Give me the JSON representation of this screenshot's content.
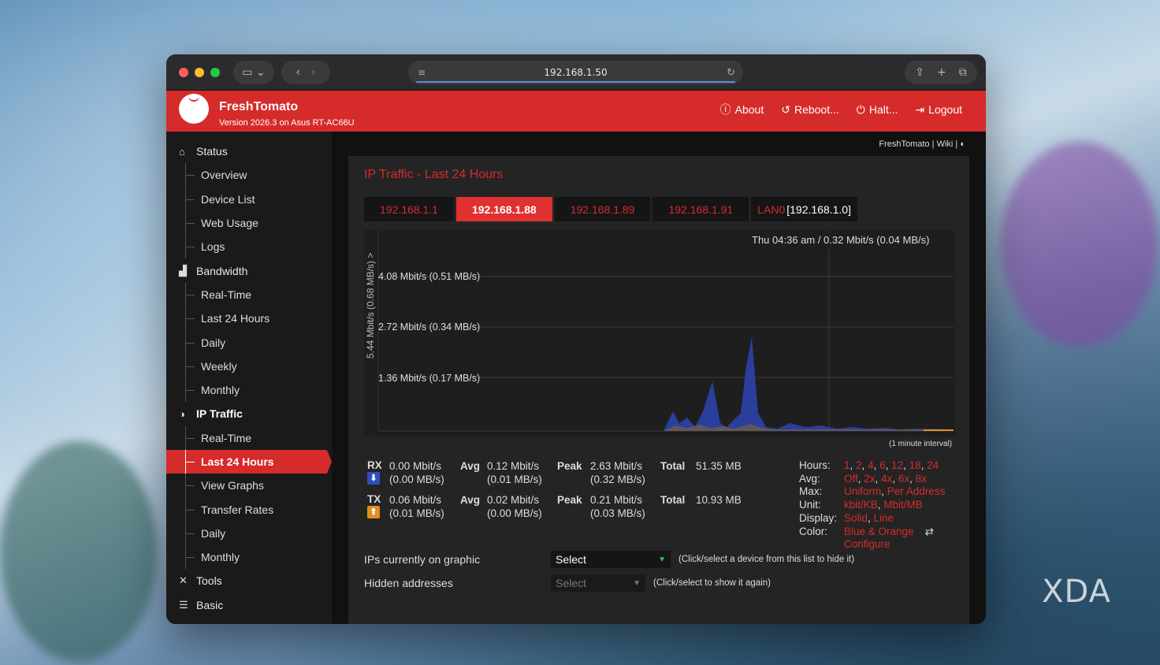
{
  "browser": {
    "url": "192.168.1.50",
    "colors": {
      "close": "#ff5f57",
      "minimize": "#febc2e",
      "zoom": "#28c840"
    }
  },
  "header": {
    "brand": "FreshTomato",
    "version": "Version 2026.3 on Asus RT-AC66U",
    "nav": {
      "about": "About",
      "reboot": "Reboot...",
      "halt": "Halt...",
      "logout": "Logout"
    },
    "accent": "#d62b2b"
  },
  "breadcrumb": {
    "home": "FreshTomato",
    "wiki": "Wiki"
  },
  "sidebar": {
    "status": "Status",
    "status_items": [
      "Overview",
      "Device List",
      "Web Usage",
      "Logs"
    ],
    "bandwidth": "Bandwidth",
    "bandwidth_items": [
      "Real-Time",
      "Last 24 Hours",
      "Daily",
      "Weekly",
      "Monthly"
    ],
    "ip_traffic": "IP Traffic",
    "ip_items": [
      "Real-Time",
      "Last 24 Hours",
      "View Graphs",
      "Transfer Rates",
      "Daily",
      "Monthly"
    ],
    "tools": "Tools",
    "basic": "Basic"
  },
  "panel": {
    "title": "IP Traffic - Last 24 Hours",
    "tabs": [
      "192.168.1.1",
      "192.168.1.88",
      "192.168.1.89",
      "192.168.1.91"
    ],
    "lan_tab": {
      "name": "LAN0",
      "subnet": "[192.168.1.0]"
    }
  },
  "graph": {
    "y_axis_label": "5.44 Mbit/s (0.68 MB/s) >",
    "gridlines": [
      "4.08 Mbit/s (0.51 MB/s)",
      "2.72 Mbit/s (0.34 MB/s)",
      "1.36 Mbit/s (0.17 MB/s)"
    ],
    "cursor_readout": "Thu 04:36 am / 0.32 Mbit/s (0.04 MB/s)",
    "interval": "(1 minute interval)"
  },
  "stats": {
    "rx": {
      "label": "RX",
      "rate": "0.00 Mbit/s",
      "rate_mb": "(0.00 MB/s)",
      "avg_label": "Avg",
      "avg": "0.12 Mbit/s",
      "avg_mb": "(0.01 MB/s)",
      "peak_label": "Peak",
      "peak": "2.63 Mbit/s",
      "peak_mb": "(0.32 MB/s)",
      "total_label": "Total",
      "total": "51.35 MB"
    },
    "tx": {
      "label": "TX",
      "rate": "0.06 Mbit/s",
      "rate_mb": "(0.01 MB/s)",
      "avg_label": "Avg",
      "avg": "0.02 Mbit/s",
      "avg_mb": "(0.00 MB/s)",
      "peak_label": "Peak",
      "peak": "0.21 Mbit/s",
      "peak_mb": "(0.03 MB/s)",
      "total_label": "Total",
      "total": "10.93 MB"
    }
  },
  "options": {
    "hours_label": "Hours:",
    "hours": [
      "1",
      "2",
      "4",
      "6",
      "12",
      "18",
      "24"
    ],
    "avg_label": "Avg:",
    "avg": [
      "Off",
      "2x",
      "4x",
      "6x",
      "8x"
    ],
    "max_label": "Max:",
    "max": [
      "Uniform",
      "Per Address"
    ],
    "unit_label": "Unit:",
    "unit": [
      "kbit/KB",
      "Mbit/MB"
    ],
    "display_label": "Display:",
    "display": [
      "Solid",
      "Line"
    ],
    "color_label": "Color:",
    "color": "Blue & Orange",
    "configure": "Configure"
  },
  "form": {
    "ips_label": "IPs currently on graphic",
    "ips_select": "Select",
    "ips_hint": "(Click/select a device from this list to hide it)",
    "hidden_label": "Hidden addresses",
    "hidden_select": "Select",
    "hidden_hint": "(Click/select to show it again)"
  },
  "watermark": "XDA"
}
